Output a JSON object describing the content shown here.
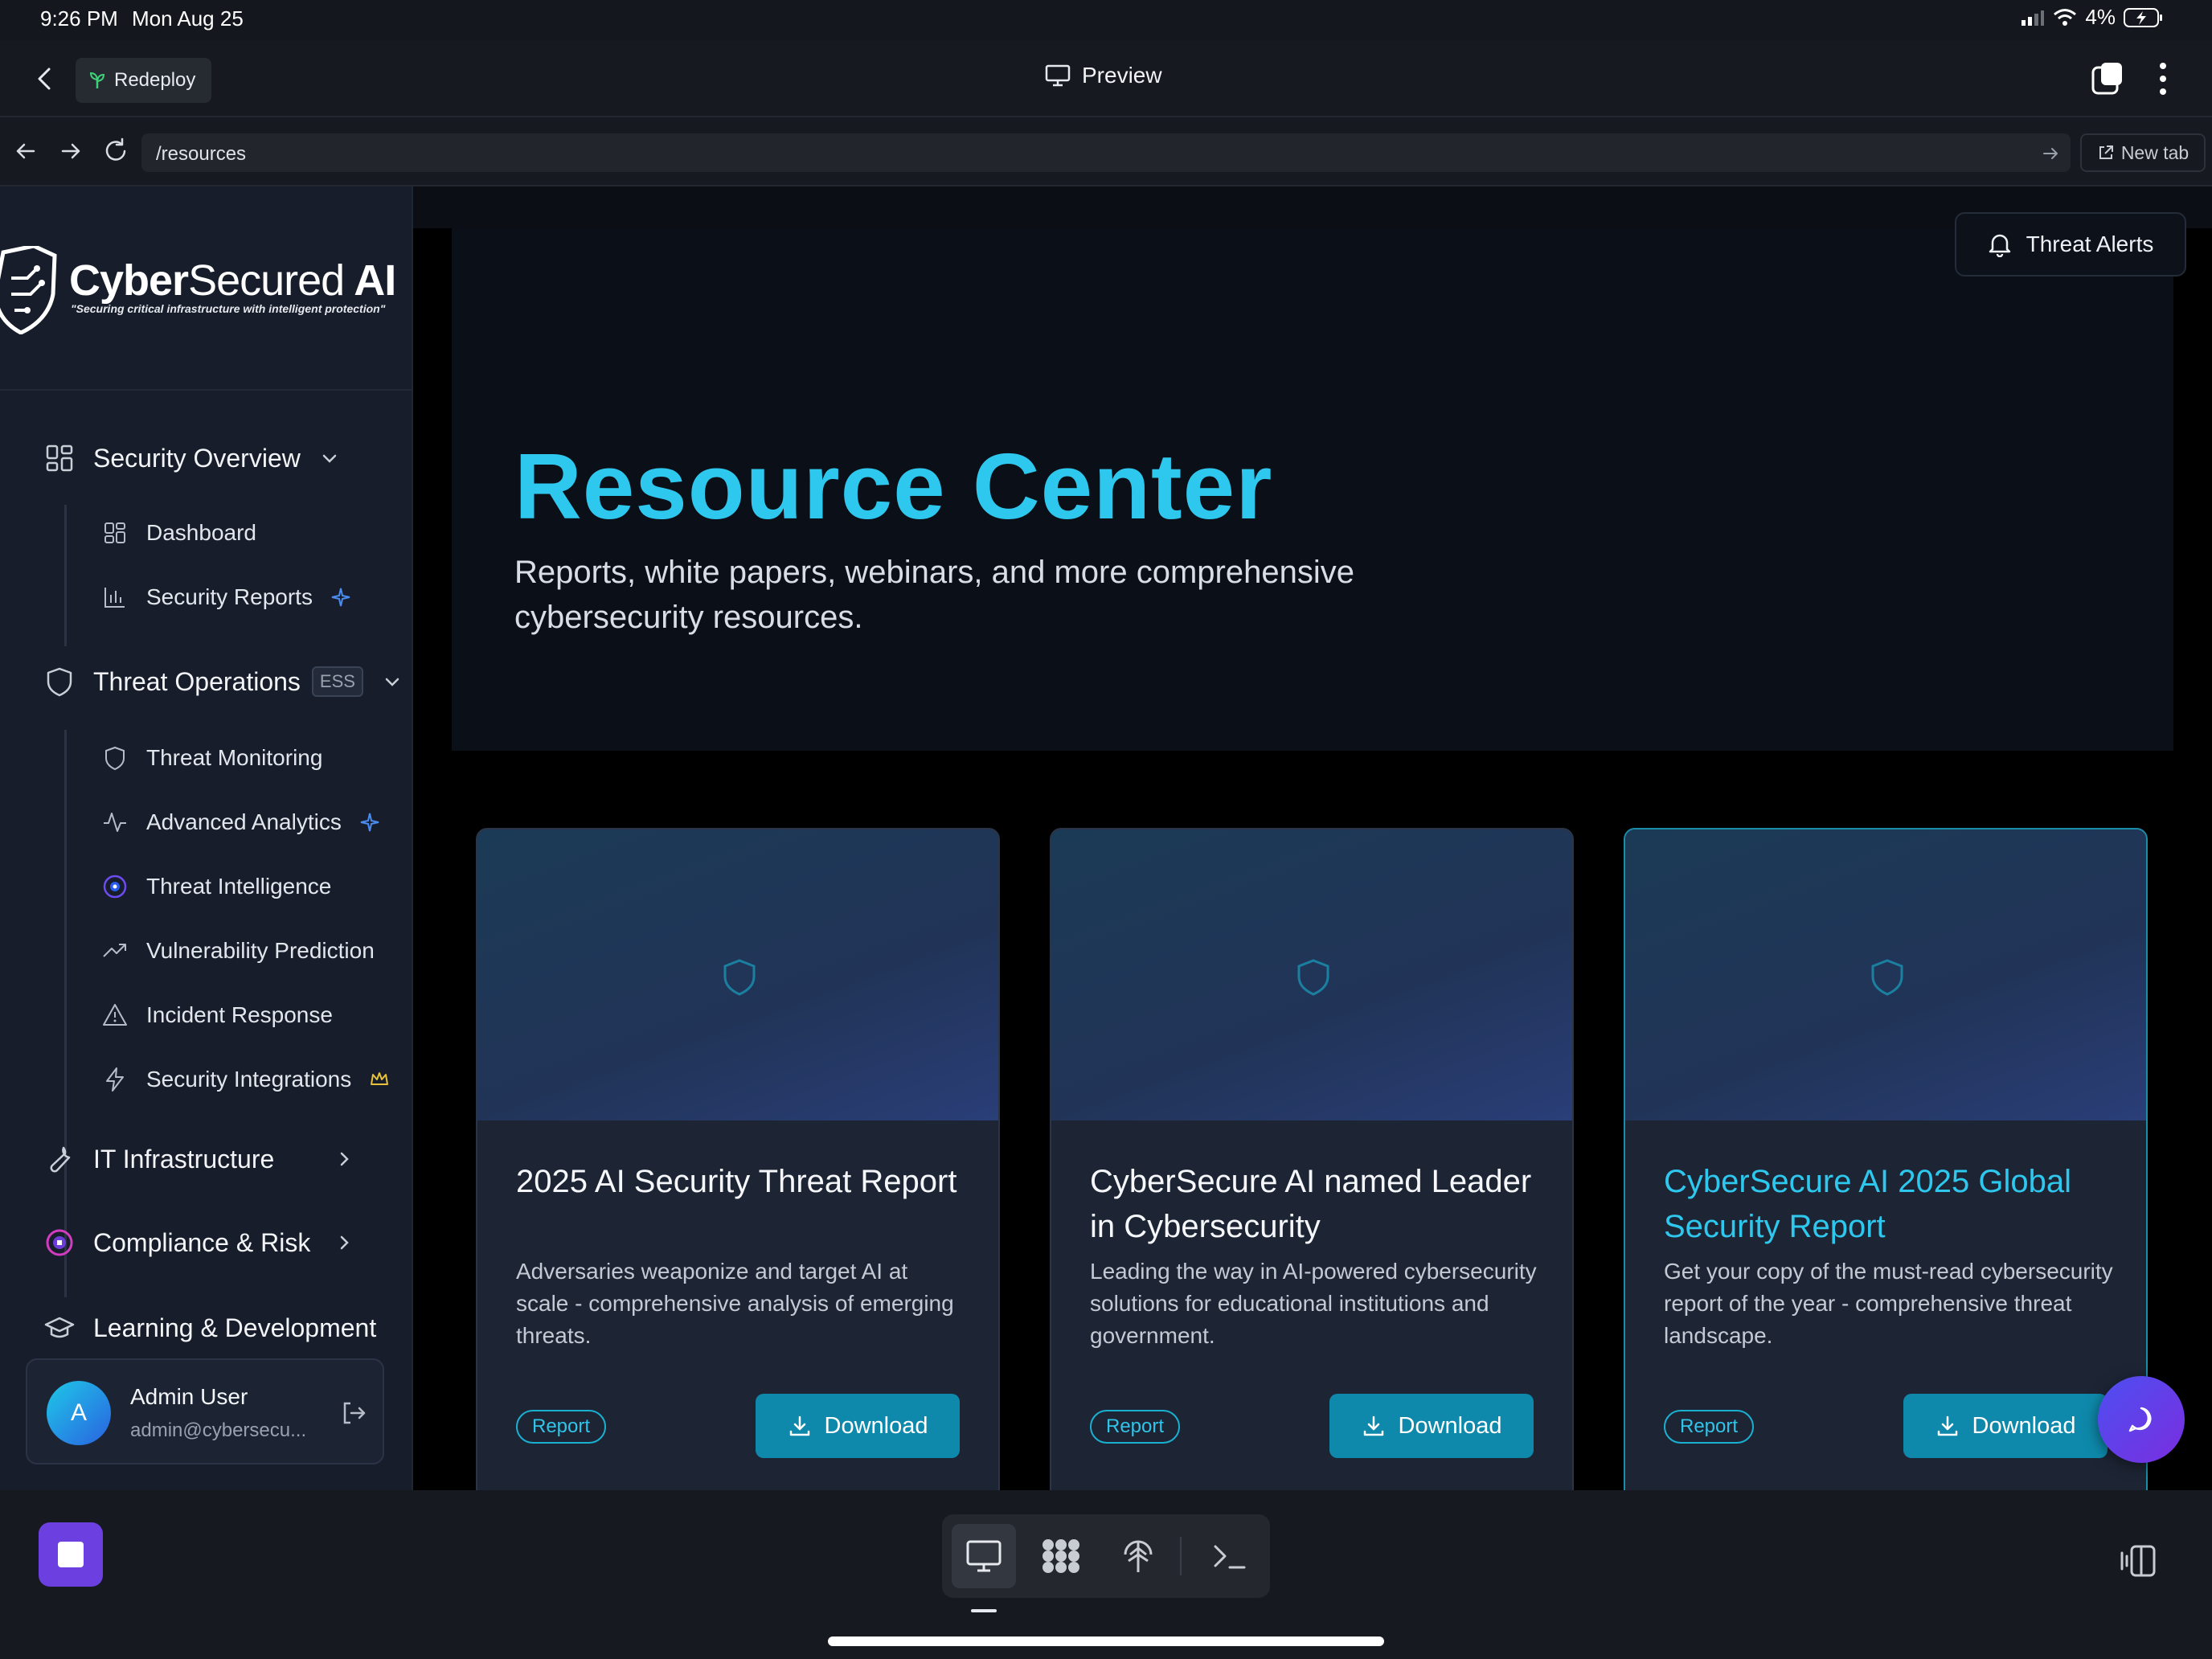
{
  "status": {
    "time": "9:26 PM",
    "date": "Mon Aug 25",
    "battery": "4%"
  },
  "header": {
    "redeploy_label": "Redeploy",
    "preview_label": "Preview"
  },
  "urlbar": {
    "url": "/resources",
    "new_tab_label": "New tab"
  },
  "brand": {
    "name_bold": "Cyber",
    "name_thin": "Secured",
    "name_suffix": "AI",
    "tagline": "\"Securing critical infrastructure with intelligent protection\""
  },
  "sidebar": {
    "groups": [
      {
        "label": "Security Overview",
        "icon": "grid-icon"
      },
      {
        "label": "Threat Operations",
        "badge": "ESS",
        "icon": "shield-icon"
      },
      {
        "label": "IT Infrastructure",
        "icon": "wrench-icon"
      },
      {
        "label": "Compliance & Risk",
        "icon": "compliance-icon"
      },
      {
        "label": "Learning & Development",
        "icon": "graduation-cap-icon"
      }
    ],
    "overview_items": [
      {
        "label": "Dashboard",
        "icon": "grid-icon"
      },
      {
        "label": "Security Reports",
        "icon": "bar-chart-icon"
      }
    ],
    "threat_items": [
      {
        "label": "Threat Monitoring",
        "icon": "shield-icon"
      },
      {
        "label": "Advanced Analytics",
        "icon": "activity-icon"
      },
      {
        "label": "Threat Intelligence",
        "icon": "eye-target-icon"
      },
      {
        "label": "Vulnerability Prediction",
        "icon": "trending-up-icon"
      },
      {
        "label": "Incident Response",
        "icon": "alert-triangle-icon"
      },
      {
        "label": "Security Integrations",
        "icon": "lightning-icon"
      }
    ],
    "user": {
      "initial": "A",
      "name": "Admin User",
      "email": "admin@cybersecu..."
    }
  },
  "main": {
    "threat_alerts_label": "Threat Alerts",
    "title": "Resource Center",
    "subtitle": "Reports, white papers, webinars, and more comprehensive cybersecurity resources.",
    "cards": [
      {
        "title": "2025 AI Security Threat Report",
        "description": "Adversaries weaponize and target AI at scale - comprehensive analysis of emerging threats.",
        "tag": "Report",
        "button": "Download"
      },
      {
        "title": "CyberSecure AI named Leader in Cybersecurity",
        "description": "Leading the way in AI-powered cybersecurity solutions for educational institutions and government.",
        "tag": "Report",
        "button": "Download"
      },
      {
        "title": "CyberSecure AI 2025 Global Security Report",
        "description": "Get your copy of the must-read cybersecurity report of the year - comprehensive threat landscape.",
        "tag": "Report",
        "button": "Download"
      }
    ]
  },
  "colors": {
    "accent": "#2ec8ee",
    "button": "#0e89ab",
    "sidebar_bg": "#171d2a",
    "stop_button": "#6b3fe0"
  }
}
